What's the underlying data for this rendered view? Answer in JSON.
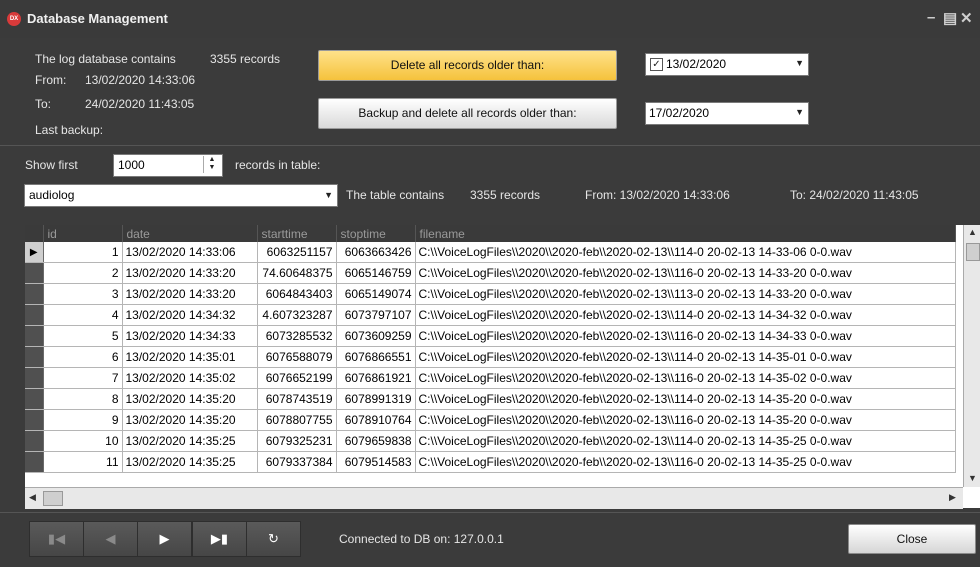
{
  "window": {
    "title": "Database Management",
    "icon_text": "DX"
  },
  "summary": {
    "contains_label": "The log database contains",
    "record_count": "3355 records",
    "from_label": "From:",
    "from_value": "13/02/2020 14:33:06",
    "to_label": "To:",
    "to_value": "24/02/2020 11:43:05",
    "last_backup_label": "Last backup:"
  },
  "actions": {
    "delete_label": "Delete all records older than:",
    "delete_date": "13/02/2020",
    "delete_checked": true,
    "backup_label": "Backup and delete all records older than:",
    "backup_date": "17/02/2020"
  },
  "filter": {
    "show_first_label": "Show first",
    "show_first_value": "1000",
    "records_label": "records in table:",
    "table_selected": "audiolog",
    "table_contains_label": "The table contains",
    "table_count": "3355 records",
    "table_from": "From:  13/02/2020 14:33:06",
    "table_to": "To:  24/02/2020 11:43:05"
  },
  "grid": {
    "columns": [
      "id",
      "date",
      "starttime",
      "stoptime",
      "filename"
    ],
    "rows": [
      [
        "1",
        "13/02/2020 14:33:06",
        "6063251157",
        "6063663426",
        "C:\\\\VoiceLogFiles\\\\2020\\\\2020-feb\\\\2020-02-13\\\\114-0 20-02-13 14-33-06 0-0.wav"
      ],
      [
        "2",
        "13/02/2020 14:33:20",
        "74.60648375",
        "6065146759",
        "C:\\\\VoiceLogFiles\\\\2020\\\\2020-feb\\\\2020-02-13\\\\116-0 20-02-13 14-33-20 0-0.wav"
      ],
      [
        "3",
        "13/02/2020 14:33:20",
        "6064843403",
        "6065149074",
        "C:\\\\VoiceLogFiles\\\\2020\\\\2020-feb\\\\2020-02-13\\\\113-0 20-02-13 14-33-20 0-0.wav"
      ],
      [
        "4",
        "13/02/2020 14:34:32",
        "4.607323287",
        "6073797107",
        "C:\\\\VoiceLogFiles\\\\2020\\\\2020-feb\\\\2020-02-13\\\\114-0 20-02-13 14-34-32 0-0.wav"
      ],
      [
        "5",
        "13/02/2020 14:34:33",
        "6073285532",
        "6073609259",
        "C:\\\\VoiceLogFiles\\\\2020\\\\2020-feb\\\\2020-02-13\\\\116-0 20-02-13 14-34-33 0-0.wav"
      ],
      [
        "6",
        "13/02/2020 14:35:01",
        "6076588079",
        "6076866551",
        "C:\\\\VoiceLogFiles\\\\2020\\\\2020-feb\\\\2020-02-13\\\\114-0 20-02-13 14-35-01 0-0.wav"
      ],
      [
        "7",
        "13/02/2020 14:35:02",
        "6076652199",
        "6076861921",
        "C:\\\\VoiceLogFiles\\\\2020\\\\2020-feb\\\\2020-02-13\\\\116-0 20-02-13 14-35-02 0-0.wav"
      ],
      [
        "8",
        "13/02/2020 14:35:20",
        "6078743519",
        "6078991319",
        "C:\\\\VoiceLogFiles\\\\2020\\\\2020-feb\\\\2020-02-13\\\\114-0 20-02-13 14-35-20 0-0.wav"
      ],
      [
        "9",
        "13/02/2020 14:35:20",
        "6078807755",
        "6078910764",
        "C:\\\\VoiceLogFiles\\\\2020\\\\2020-feb\\\\2020-02-13\\\\116-0 20-02-13 14-35-20 0-0.wav"
      ],
      [
        "10",
        "13/02/2020 14:35:25",
        "6079325231",
        "6079659838",
        "C:\\\\VoiceLogFiles\\\\2020\\\\2020-feb\\\\2020-02-13\\\\114-0 20-02-13 14-35-25 0-0.wav"
      ],
      [
        "11",
        "13/02/2020 14:35:25",
        "6079337384",
        "6079514583",
        "C:\\\\VoiceLogFiles\\\\2020\\\\2020-feb\\\\2020-02-13\\\\116-0 20-02-13 14-35-25 0-0.wav"
      ]
    ]
  },
  "footer": {
    "status": "Connected to DB on: 127.0.0.1",
    "close_label": "Close",
    "nav_icons": [
      "first-record-icon",
      "previous-record-icon",
      "next-record-icon",
      "last-record-icon",
      "refresh-icon"
    ]
  },
  "colors": {
    "accent_button": "#f5c23c",
    "window_bg": "#3b3b3b",
    "title_icon": "#d83a3a"
  }
}
